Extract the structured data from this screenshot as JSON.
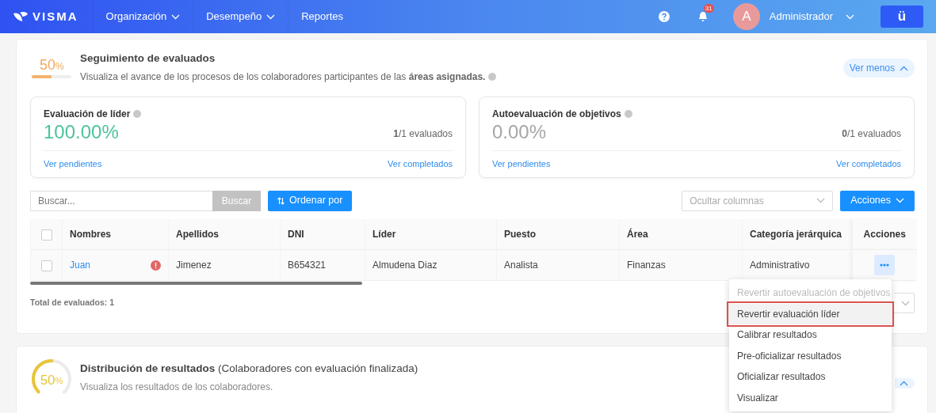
{
  "navbar": {
    "logo": "VISMA",
    "menu": [
      {
        "label": "Organización",
        "dropdown": true
      },
      {
        "label": "Desempeño",
        "dropdown": true
      },
      {
        "label": "Reportes",
        "dropdown": false
      }
    ],
    "notifications": "31",
    "avatar_initial": "A",
    "user": "Administrador",
    "app_button": "ü"
  },
  "tracking": {
    "percent": "50",
    "percent_sign": "%",
    "level": 0.5,
    "title": "Seguimiento de evaluados",
    "description": "Visualiza el avance de los procesos de los colaboradores participantes de las **áreas asignadas.**",
    "toggle": "Ver menos"
  },
  "stats": [
    {
      "title": "Evaluación de líder",
      "value": "100.00%",
      "color": "#4dc39e",
      "count": "**1**/1 evaluados",
      "pending_link": "Ver pendientes",
      "completed_link": "Ver completados"
    },
    {
      "title": "Autoevaluación de objetivos",
      "value": "0.00%",
      "color": "#a6a6a6",
      "count": "**0**/1 evaluados",
      "pending_link": "Ver pendientes",
      "completed_link": "Ver completados"
    }
  ],
  "toolbar": {
    "search_placeholder": "Buscar...",
    "search_button": "Buscar",
    "sort_button": "Ordenar por",
    "columns_placeholder": "Ocultar columnas",
    "actions_button": "Acciones"
  },
  "table": {
    "columns": [
      "Nombres",
      "Apellidos",
      "DNI",
      "Líder",
      "Puesto",
      "Área",
      "Categoría jerárquica",
      "Acciones"
    ],
    "all_selected": false,
    "rows": [
      {
        "selected": false,
        "warning": true,
        "cells": [
          "Juan",
          "Jimenez",
          "B654321",
          "Almudena Diaz",
          "Analista",
          "Finanzas",
          "Administrativo"
        ]
      }
    ]
  },
  "total": "Total de evaluados: 1",
  "row_menu": {
    "items": [
      {
        "label": "Revertir autoevaluación de objetivos",
        "disabled": true,
        "selected": false
      },
      {
        "label": "Revertir evaluación líder",
        "disabled": false,
        "selected": true
      },
      {
        "label": "Calibrar resultados",
        "disabled": false,
        "selected": false
      },
      {
        "label": "Pre-oficializar resultados",
        "disabled": false,
        "selected": false
      },
      {
        "label": "Oficializar resultados",
        "disabled": false,
        "selected": false
      },
      {
        "label": "Visualizar",
        "disabled": false,
        "selected": false
      }
    ]
  },
  "distribution": {
    "percent": "50",
    "percent_sign": "%",
    "level": 0.5,
    "title": "**Distribución de resultados** (Colaboradores con evaluación finalizada)",
    "description": "Visualiza los resultados de los colaboradores."
  }
}
